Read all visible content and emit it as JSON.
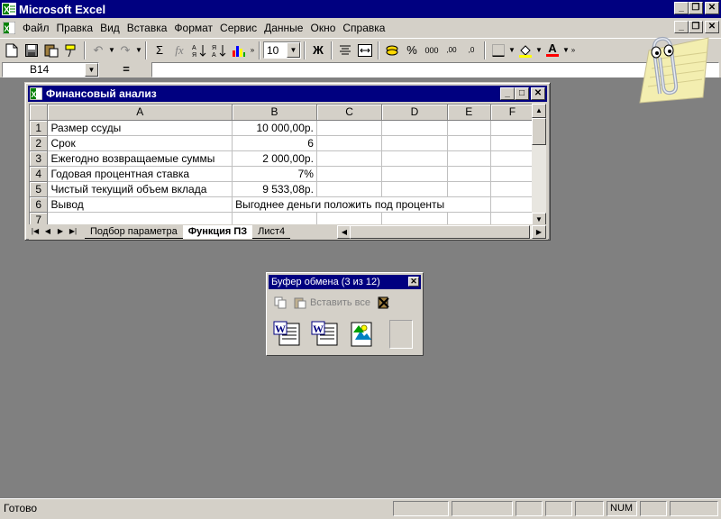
{
  "app": {
    "title": "Microsoft Excel",
    "accent_color": "#000080",
    "chrome_color": "#d4d0c8",
    "desktop_color": "#808080"
  },
  "window_controls": {
    "minimize": "_",
    "restore": "❐",
    "close": "✕"
  },
  "menu": {
    "items": [
      {
        "label": "Файл"
      },
      {
        "label": "Правка"
      },
      {
        "label": "Вид"
      },
      {
        "label": "Вставка"
      },
      {
        "label": "Формат"
      },
      {
        "label": "Сервис"
      },
      {
        "label": "Данные"
      },
      {
        "label": "Окно"
      },
      {
        "label": "Справка"
      }
    ]
  },
  "toolbar": {
    "font_size": "10",
    "buttons": [
      {
        "name": "new-icon"
      },
      {
        "name": "save-icon"
      },
      {
        "name": "paste-icon"
      },
      {
        "name": "format-painter-icon"
      },
      {
        "name": "undo-icon"
      },
      {
        "name": "redo-icon"
      },
      {
        "name": "autosum-icon"
      },
      {
        "name": "function-icon"
      },
      {
        "name": "sort-ascending-icon"
      },
      {
        "name": "sort-descending-icon"
      },
      {
        "name": "chart-wizard-icon"
      },
      {
        "name": "bold-icon"
      },
      {
        "name": "align-center-icon"
      },
      {
        "name": "merge-center-icon"
      },
      {
        "name": "currency-icon"
      },
      {
        "name": "percent-icon"
      },
      {
        "name": "thousands-icon"
      },
      {
        "name": "increase-decimal-icon"
      },
      {
        "name": "decrease-decimal-icon"
      },
      {
        "name": "borders-icon"
      },
      {
        "name": "fill-color-icon"
      },
      {
        "name": "font-color-icon"
      }
    ],
    "bold_label": "Ж",
    "percent_label": "%",
    "thousands_label": "000",
    "sigma_label": "Σ",
    "fx_label": "fx",
    "font_color_label": "A"
  },
  "formula_bar": {
    "name_box": "B14",
    "equals_label": "=",
    "formula": ""
  },
  "workbook": {
    "title": "Финансовый анализ",
    "columns": [
      "A",
      "B",
      "C",
      "D",
      "E",
      "F"
    ],
    "rows": [
      {
        "num": "1",
        "a": "Размер ссуды",
        "b": "10 000,00р."
      },
      {
        "num": "2",
        "a": "Срок",
        "b": "6"
      },
      {
        "num": "3",
        "a": "Ежегодно возвращаемые суммы",
        "b": "2 000,00р."
      },
      {
        "num": "4",
        "a": "Годовая процентная ставка",
        "b": "7%"
      },
      {
        "num": "5",
        "a": "Чистый текущий объем вклада",
        "b": "9 533,08р."
      },
      {
        "num": "6",
        "a": "Вывод",
        "b": "Выгоднее деньги положить под проценты"
      },
      {
        "num": "7",
        "a": "",
        "b": ""
      }
    ],
    "tabs": [
      {
        "label": "Подбор параметра",
        "active": false
      },
      {
        "label": "Функция ПЗ",
        "active": true
      },
      {
        "label": "Лист4",
        "active": false
      }
    ]
  },
  "clipboard": {
    "title": "Буфер обмена (3 из 12)",
    "paste_all_label": "Вставить все",
    "items": [
      {
        "type": "word-doc-icon"
      },
      {
        "type": "word-doc-icon"
      },
      {
        "type": "picture-icon"
      },
      {
        "type": "empty-slot"
      }
    ]
  },
  "status": {
    "text": "Готово",
    "num_indicator": "NUM"
  }
}
